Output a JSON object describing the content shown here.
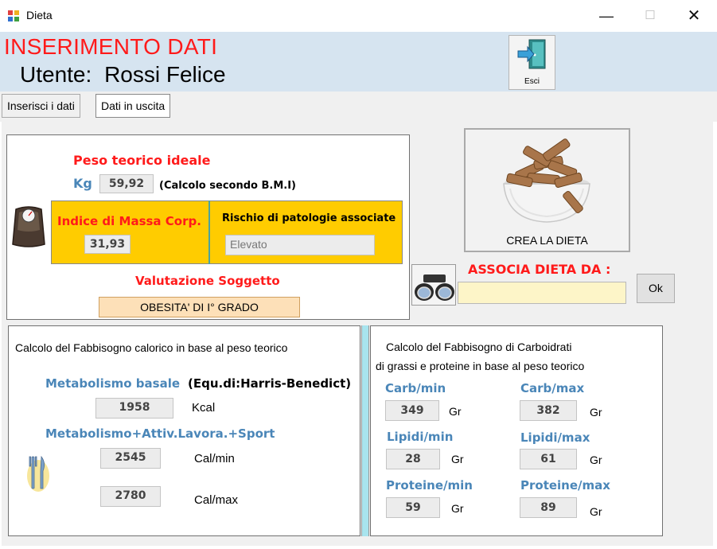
{
  "window": {
    "title": "Dieta",
    "controls": {
      "minimize": "—",
      "maximize": "☐",
      "close": "✕"
    }
  },
  "header": {
    "title": "INSERIMENTO DATI",
    "user_prefix": "Utente:",
    "user_name": "Rossi Felice",
    "exit_label": "Esci"
  },
  "tabs": [
    {
      "label": "Inserisci i dati"
    },
    {
      "label": "Dati in uscita"
    }
  ],
  "bmi_section": {
    "peso_label": "Peso teorico ideale",
    "kg_label": "Kg",
    "peso_value": "59,92",
    "bmi_note": "(Calcolo secondo B.M.I)",
    "imc_label": "Indice di Massa Corp.",
    "imc_value": "31,93",
    "risk_label": "Rischio di patologie associate",
    "risk_value": "Elevato",
    "valutazione_label": "Valutazione Soggetto",
    "valutazione_value": "OBESITA' DI  I° GRADO"
  },
  "diet": {
    "crea_label": "CREA LA DIETA",
    "associa_label": "ASSOCIA DIETA DA :",
    "associa_value": "",
    "ok_label": "Ok"
  },
  "calorie_section": {
    "title": "Calcolo del Fabbisogno  calorico  in base al peso teorico",
    "metabolismo_label": "Metabolismo basale",
    "metabolismo_note": "(Equ.di:Harris-Benedict)",
    "metabolismo_value": "1958",
    "metabolismo_unit": "Kcal",
    "sport_label": "Metabolismo+Attiv.Lavora.+Sport",
    "cal_min_value": "2545",
    "cal_min_unit": "Cal/min",
    "cal_max_value": "2780",
    "cal_max_unit": "Cal/max"
  },
  "macro_section": {
    "title_line1": "Calcolo del Fabbisogno  di Carboidrati",
    "title_line2": "di grassi e proteine in base al peso teorico",
    "unit": "Gr",
    "carb_min_label": "Carb/min",
    "carb_min_value": "349",
    "carb_max_label": "Carb/max",
    "carb_max_value": "382",
    "lipidi_min_label": "Lipidi/min",
    "lipidi_min_value": "28",
    "lipidi_max_label": "Lipidi/max",
    "lipidi_max_value": "61",
    "proteine_min_label": "Proteine/min",
    "proteine_min_value": "59",
    "proteine_max_label": "Proteine/max",
    "proteine_max_value": "89"
  },
  "icons": {
    "app": "app-icon",
    "exit": "exit-door-icon",
    "scale": "scale-icon",
    "pasta": "pasta-bowl-icon",
    "binoculars": "binoculars-icon",
    "cutlery": "cutlery-icon"
  },
  "colors": {
    "header_bg": "#d6e4f0",
    "title_red": "#ff1a1a",
    "label_blue": "#4a86b8",
    "yellow_panel": "#ffcc00",
    "result_field": "#fde0b8",
    "input_field": "#fdf5c8",
    "splitter": "#a8e4ee"
  }
}
